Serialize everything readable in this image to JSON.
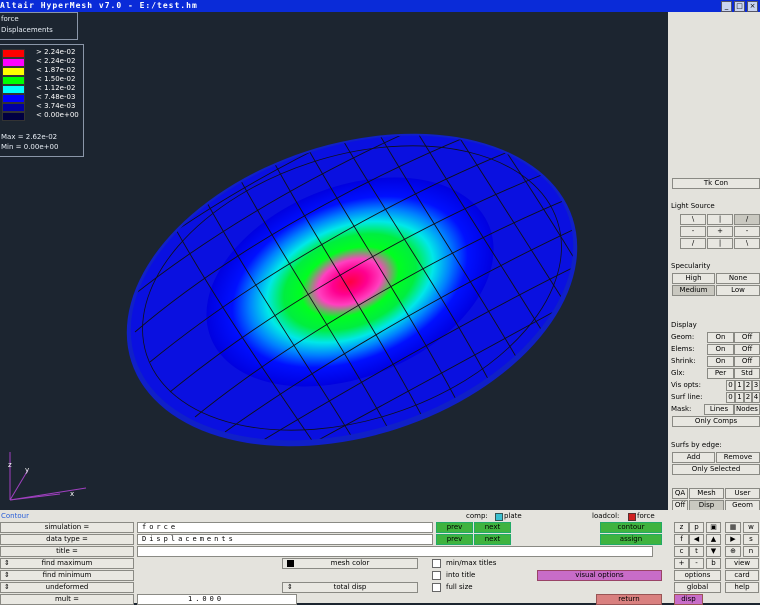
{
  "window": {
    "title": "Altair HyperMesh v7.0 - E:/test.hm",
    "buttons": [
      "_",
      "□",
      "×"
    ]
  },
  "legend": {
    "header_lines": [
      "force",
      "Displacements"
    ],
    "entries": [
      {
        "color": "#ff0000",
        "label": "> 2.24e-02"
      },
      {
        "color": "#ff00ff",
        "label": "< 2.24e-02"
      },
      {
        "color": "#ffff00",
        "label": "< 1.87e-02"
      },
      {
        "color": "#00ff00",
        "label": "< 1.50e-02"
      },
      {
        "color": "#00ffff",
        "label": "< 1.12e-02"
      },
      {
        "color": "#0000ff",
        "label": "< 7.48e-03"
      },
      {
        "color": "#0000a0",
        "label": "< 3.74e-03"
      },
      {
        "color": "#000040",
        "label": "< 0.00e+00"
      }
    ],
    "max": "Max = 2.62e-02",
    "min": "Min = 0.00e+00"
  },
  "axes": {
    "x": "x",
    "y": "y",
    "z": "z"
  },
  "right_panel": {
    "tk_con": "Tk Con",
    "light_source_title": "Light Source",
    "light_buttons": [
      "\\",
      "|",
      "/",
      "-",
      "+",
      "-",
      "/",
      "|",
      "\\"
    ],
    "specularity_title": "Specularity",
    "spec_high": "High",
    "spec_none": "None",
    "spec_medium": "Medium",
    "spec_low": "Low",
    "display_title": "Display",
    "display_rows": [
      {
        "label": "Geom:",
        "a": "On",
        "b": "Off"
      },
      {
        "label": "Elems:",
        "a": "On",
        "b": "Off"
      },
      {
        "label": "Shrink:",
        "a": "On",
        "b": "Off"
      },
      {
        "label": "Glx:",
        "a": "Per",
        "b": "Std"
      }
    ],
    "vis_opts_label": "Vis opts:",
    "vis_opts": [
      "0",
      "1",
      "2",
      "3"
    ],
    "surf_line_label": "Surf line:",
    "surf_line": [
      "0",
      "1",
      "2",
      "4"
    ],
    "mask_label": "Mask:",
    "mask_lines": "Lines",
    "mask_nodes": "Nodes",
    "only_comps": "Only Comps",
    "surfs_title": "Surfs by edge:",
    "add": "Add",
    "remove": "Remove",
    "only_selected": "Only Selected",
    "qa": "QA",
    "mesh": "Mesh",
    "user": "User",
    "off": "Off",
    "disp": "Disp",
    "geom": "Geom"
  },
  "bottom": {
    "panel_title": "Contour",
    "comp_label": "comp:",
    "comp_value": "plate",
    "loadcol_label": "loadcol:",
    "loadcol_value": "force",
    "simulation": "simulation",
    "data_type": "data type",
    "title": "title",
    "find_max": "find maximum",
    "find_min": "find minimum",
    "undeformed": "undeformed",
    "mult": "mult",
    "mult_value": "1.000",
    "sim_value": "force",
    "datatype_value": "Displacements",
    "prev": "prev",
    "next": "next",
    "contour": "contour",
    "assign": "assign",
    "mesh_color": "mesh color",
    "total_disp": "total disp",
    "minmax_titles": "min/max titles",
    "into_title": "into title",
    "full_size": "full size",
    "visual_options": "visual options",
    "return": "return"
  },
  "toolbar_grid": {
    "row1": [
      "z",
      "p",
      "▣",
      "▦",
      "w"
    ],
    "row2": [
      "f",
      "◀",
      "▲",
      "▶",
      "s"
    ],
    "row3": [
      "c",
      "t",
      "▼",
      "⊕",
      "n"
    ],
    "row4": [
      "+",
      "-",
      "b",
      "view"
    ],
    "options": "options",
    "card": "card",
    "global": "global",
    "help": "help",
    "disp": "disp"
  },
  "colors": {
    "mesh_red": "#ff0000",
    "mesh_magenta": "#ff0080",
    "mesh_yellow": "#ffff00",
    "mesh_green": "#00ff00",
    "mesh_cyan": "#00e0e0",
    "mesh_blue": "#0000ff",
    "mesh_darkblue": "#1010b8",
    "button_green": "#3fb33f",
    "button_magenta": "#c86cc8",
    "button_red": "#d9807f"
  }
}
